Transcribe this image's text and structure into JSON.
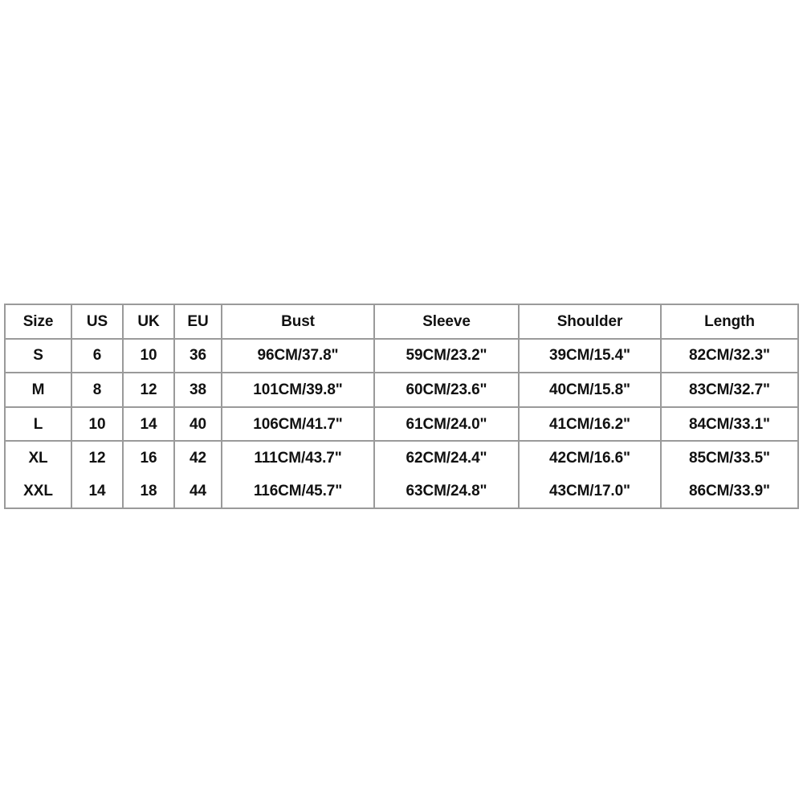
{
  "page": {
    "background_color": "#ffffff",
    "text_color": "#111111",
    "border_color": "#9a9a9a"
  },
  "size_chart": {
    "columns": [
      {
        "key": "size",
        "label": "Size"
      },
      {
        "key": "us",
        "label": "US"
      },
      {
        "key": "uk",
        "label": "UK"
      },
      {
        "key": "eu",
        "label": "EU"
      },
      {
        "key": "bust",
        "label": "Bust"
      },
      {
        "key": "sleeve",
        "label": "Sleeve"
      },
      {
        "key": "shoulder",
        "label": "Shoulder"
      },
      {
        "key": "length",
        "label": "Length"
      }
    ],
    "rows": [
      {
        "size": "S",
        "us": "6",
        "uk": "10",
        "eu": "36",
        "bust": "96CM/37.8\"",
        "sleeve": "59CM/23.2\"",
        "shoulder": "39CM/15.4\"",
        "length": "82CM/32.3\""
      },
      {
        "size": "M",
        "us": "8",
        "uk": "12",
        "eu": "38",
        "bust": "101CM/39.8\"",
        "sleeve": "60CM/23.6\"",
        "shoulder": "40CM/15.8\"",
        "length": "83CM/32.7\""
      },
      {
        "size": "L",
        "us": "10",
        "uk": "14",
        "eu": "40",
        "bust": "106CM/41.7\"",
        "sleeve": "61CM/24.0\"",
        "shoulder": "41CM/16.2\"",
        "length": "84CM/33.1\""
      },
      {
        "size": "XL",
        "us": "12",
        "uk": "16",
        "eu": "42",
        "bust": "111CM/43.7\"",
        "sleeve": "62CM/24.4\"",
        "shoulder": "42CM/16.6\"",
        "length": "85CM/33.5\""
      },
      {
        "size": "XXL",
        "us": "14",
        "uk": "18",
        "eu": "44",
        "bust": "116CM/45.7\"",
        "sleeve": "63CM/24.8\"",
        "shoulder": "43CM/17.0\"",
        "length": "86CM/33.9\""
      }
    ]
  }
}
